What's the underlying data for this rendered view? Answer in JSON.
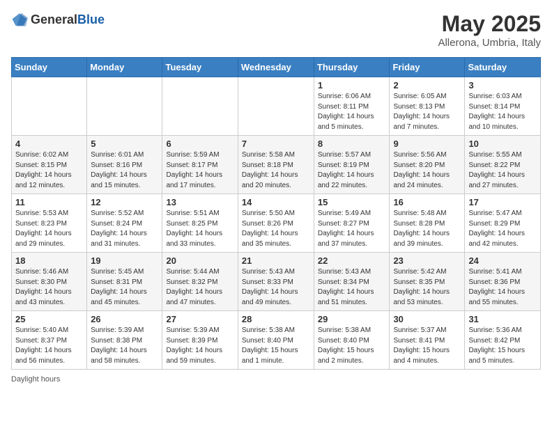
{
  "logo": {
    "general": "General",
    "blue": "Blue"
  },
  "title": "May 2025",
  "location": "Allerona, Umbria, Italy",
  "days_of_week": [
    "Sunday",
    "Monday",
    "Tuesday",
    "Wednesday",
    "Thursday",
    "Friday",
    "Saturday"
  ],
  "footer": "Daylight hours",
  "weeks": [
    [
      {
        "day": "",
        "info": ""
      },
      {
        "day": "",
        "info": ""
      },
      {
        "day": "",
        "info": ""
      },
      {
        "day": "",
        "info": ""
      },
      {
        "day": "1",
        "info": "Sunrise: 6:06 AM\nSunset: 8:11 PM\nDaylight: 14 hours and 5 minutes."
      },
      {
        "day": "2",
        "info": "Sunrise: 6:05 AM\nSunset: 8:13 PM\nDaylight: 14 hours and 7 minutes."
      },
      {
        "day": "3",
        "info": "Sunrise: 6:03 AM\nSunset: 8:14 PM\nDaylight: 14 hours and 10 minutes."
      }
    ],
    [
      {
        "day": "4",
        "info": "Sunrise: 6:02 AM\nSunset: 8:15 PM\nDaylight: 14 hours and 12 minutes."
      },
      {
        "day": "5",
        "info": "Sunrise: 6:01 AM\nSunset: 8:16 PM\nDaylight: 14 hours and 15 minutes."
      },
      {
        "day": "6",
        "info": "Sunrise: 5:59 AM\nSunset: 8:17 PM\nDaylight: 14 hours and 17 minutes."
      },
      {
        "day": "7",
        "info": "Sunrise: 5:58 AM\nSunset: 8:18 PM\nDaylight: 14 hours and 20 minutes."
      },
      {
        "day": "8",
        "info": "Sunrise: 5:57 AM\nSunset: 8:19 PM\nDaylight: 14 hours and 22 minutes."
      },
      {
        "day": "9",
        "info": "Sunrise: 5:56 AM\nSunset: 8:20 PM\nDaylight: 14 hours and 24 minutes."
      },
      {
        "day": "10",
        "info": "Sunrise: 5:55 AM\nSunset: 8:22 PM\nDaylight: 14 hours and 27 minutes."
      }
    ],
    [
      {
        "day": "11",
        "info": "Sunrise: 5:53 AM\nSunset: 8:23 PM\nDaylight: 14 hours and 29 minutes."
      },
      {
        "day": "12",
        "info": "Sunrise: 5:52 AM\nSunset: 8:24 PM\nDaylight: 14 hours and 31 minutes."
      },
      {
        "day": "13",
        "info": "Sunrise: 5:51 AM\nSunset: 8:25 PM\nDaylight: 14 hours and 33 minutes."
      },
      {
        "day": "14",
        "info": "Sunrise: 5:50 AM\nSunset: 8:26 PM\nDaylight: 14 hours and 35 minutes."
      },
      {
        "day": "15",
        "info": "Sunrise: 5:49 AM\nSunset: 8:27 PM\nDaylight: 14 hours and 37 minutes."
      },
      {
        "day": "16",
        "info": "Sunrise: 5:48 AM\nSunset: 8:28 PM\nDaylight: 14 hours and 39 minutes."
      },
      {
        "day": "17",
        "info": "Sunrise: 5:47 AM\nSunset: 8:29 PM\nDaylight: 14 hours and 42 minutes."
      }
    ],
    [
      {
        "day": "18",
        "info": "Sunrise: 5:46 AM\nSunset: 8:30 PM\nDaylight: 14 hours and 43 minutes."
      },
      {
        "day": "19",
        "info": "Sunrise: 5:45 AM\nSunset: 8:31 PM\nDaylight: 14 hours and 45 minutes."
      },
      {
        "day": "20",
        "info": "Sunrise: 5:44 AM\nSunset: 8:32 PM\nDaylight: 14 hours and 47 minutes."
      },
      {
        "day": "21",
        "info": "Sunrise: 5:43 AM\nSunset: 8:33 PM\nDaylight: 14 hours and 49 minutes."
      },
      {
        "day": "22",
        "info": "Sunrise: 5:43 AM\nSunset: 8:34 PM\nDaylight: 14 hours and 51 minutes."
      },
      {
        "day": "23",
        "info": "Sunrise: 5:42 AM\nSunset: 8:35 PM\nDaylight: 14 hours and 53 minutes."
      },
      {
        "day": "24",
        "info": "Sunrise: 5:41 AM\nSunset: 8:36 PM\nDaylight: 14 hours and 55 minutes."
      }
    ],
    [
      {
        "day": "25",
        "info": "Sunrise: 5:40 AM\nSunset: 8:37 PM\nDaylight: 14 hours and 56 minutes."
      },
      {
        "day": "26",
        "info": "Sunrise: 5:39 AM\nSunset: 8:38 PM\nDaylight: 14 hours and 58 minutes."
      },
      {
        "day": "27",
        "info": "Sunrise: 5:39 AM\nSunset: 8:39 PM\nDaylight: 14 hours and 59 minutes."
      },
      {
        "day": "28",
        "info": "Sunrise: 5:38 AM\nSunset: 8:40 PM\nDaylight: 15 hours and 1 minute."
      },
      {
        "day": "29",
        "info": "Sunrise: 5:38 AM\nSunset: 8:40 PM\nDaylight: 15 hours and 2 minutes."
      },
      {
        "day": "30",
        "info": "Sunrise: 5:37 AM\nSunset: 8:41 PM\nDaylight: 15 hours and 4 minutes."
      },
      {
        "day": "31",
        "info": "Sunrise: 5:36 AM\nSunset: 8:42 PM\nDaylight: 15 hours and 5 minutes."
      }
    ]
  ]
}
